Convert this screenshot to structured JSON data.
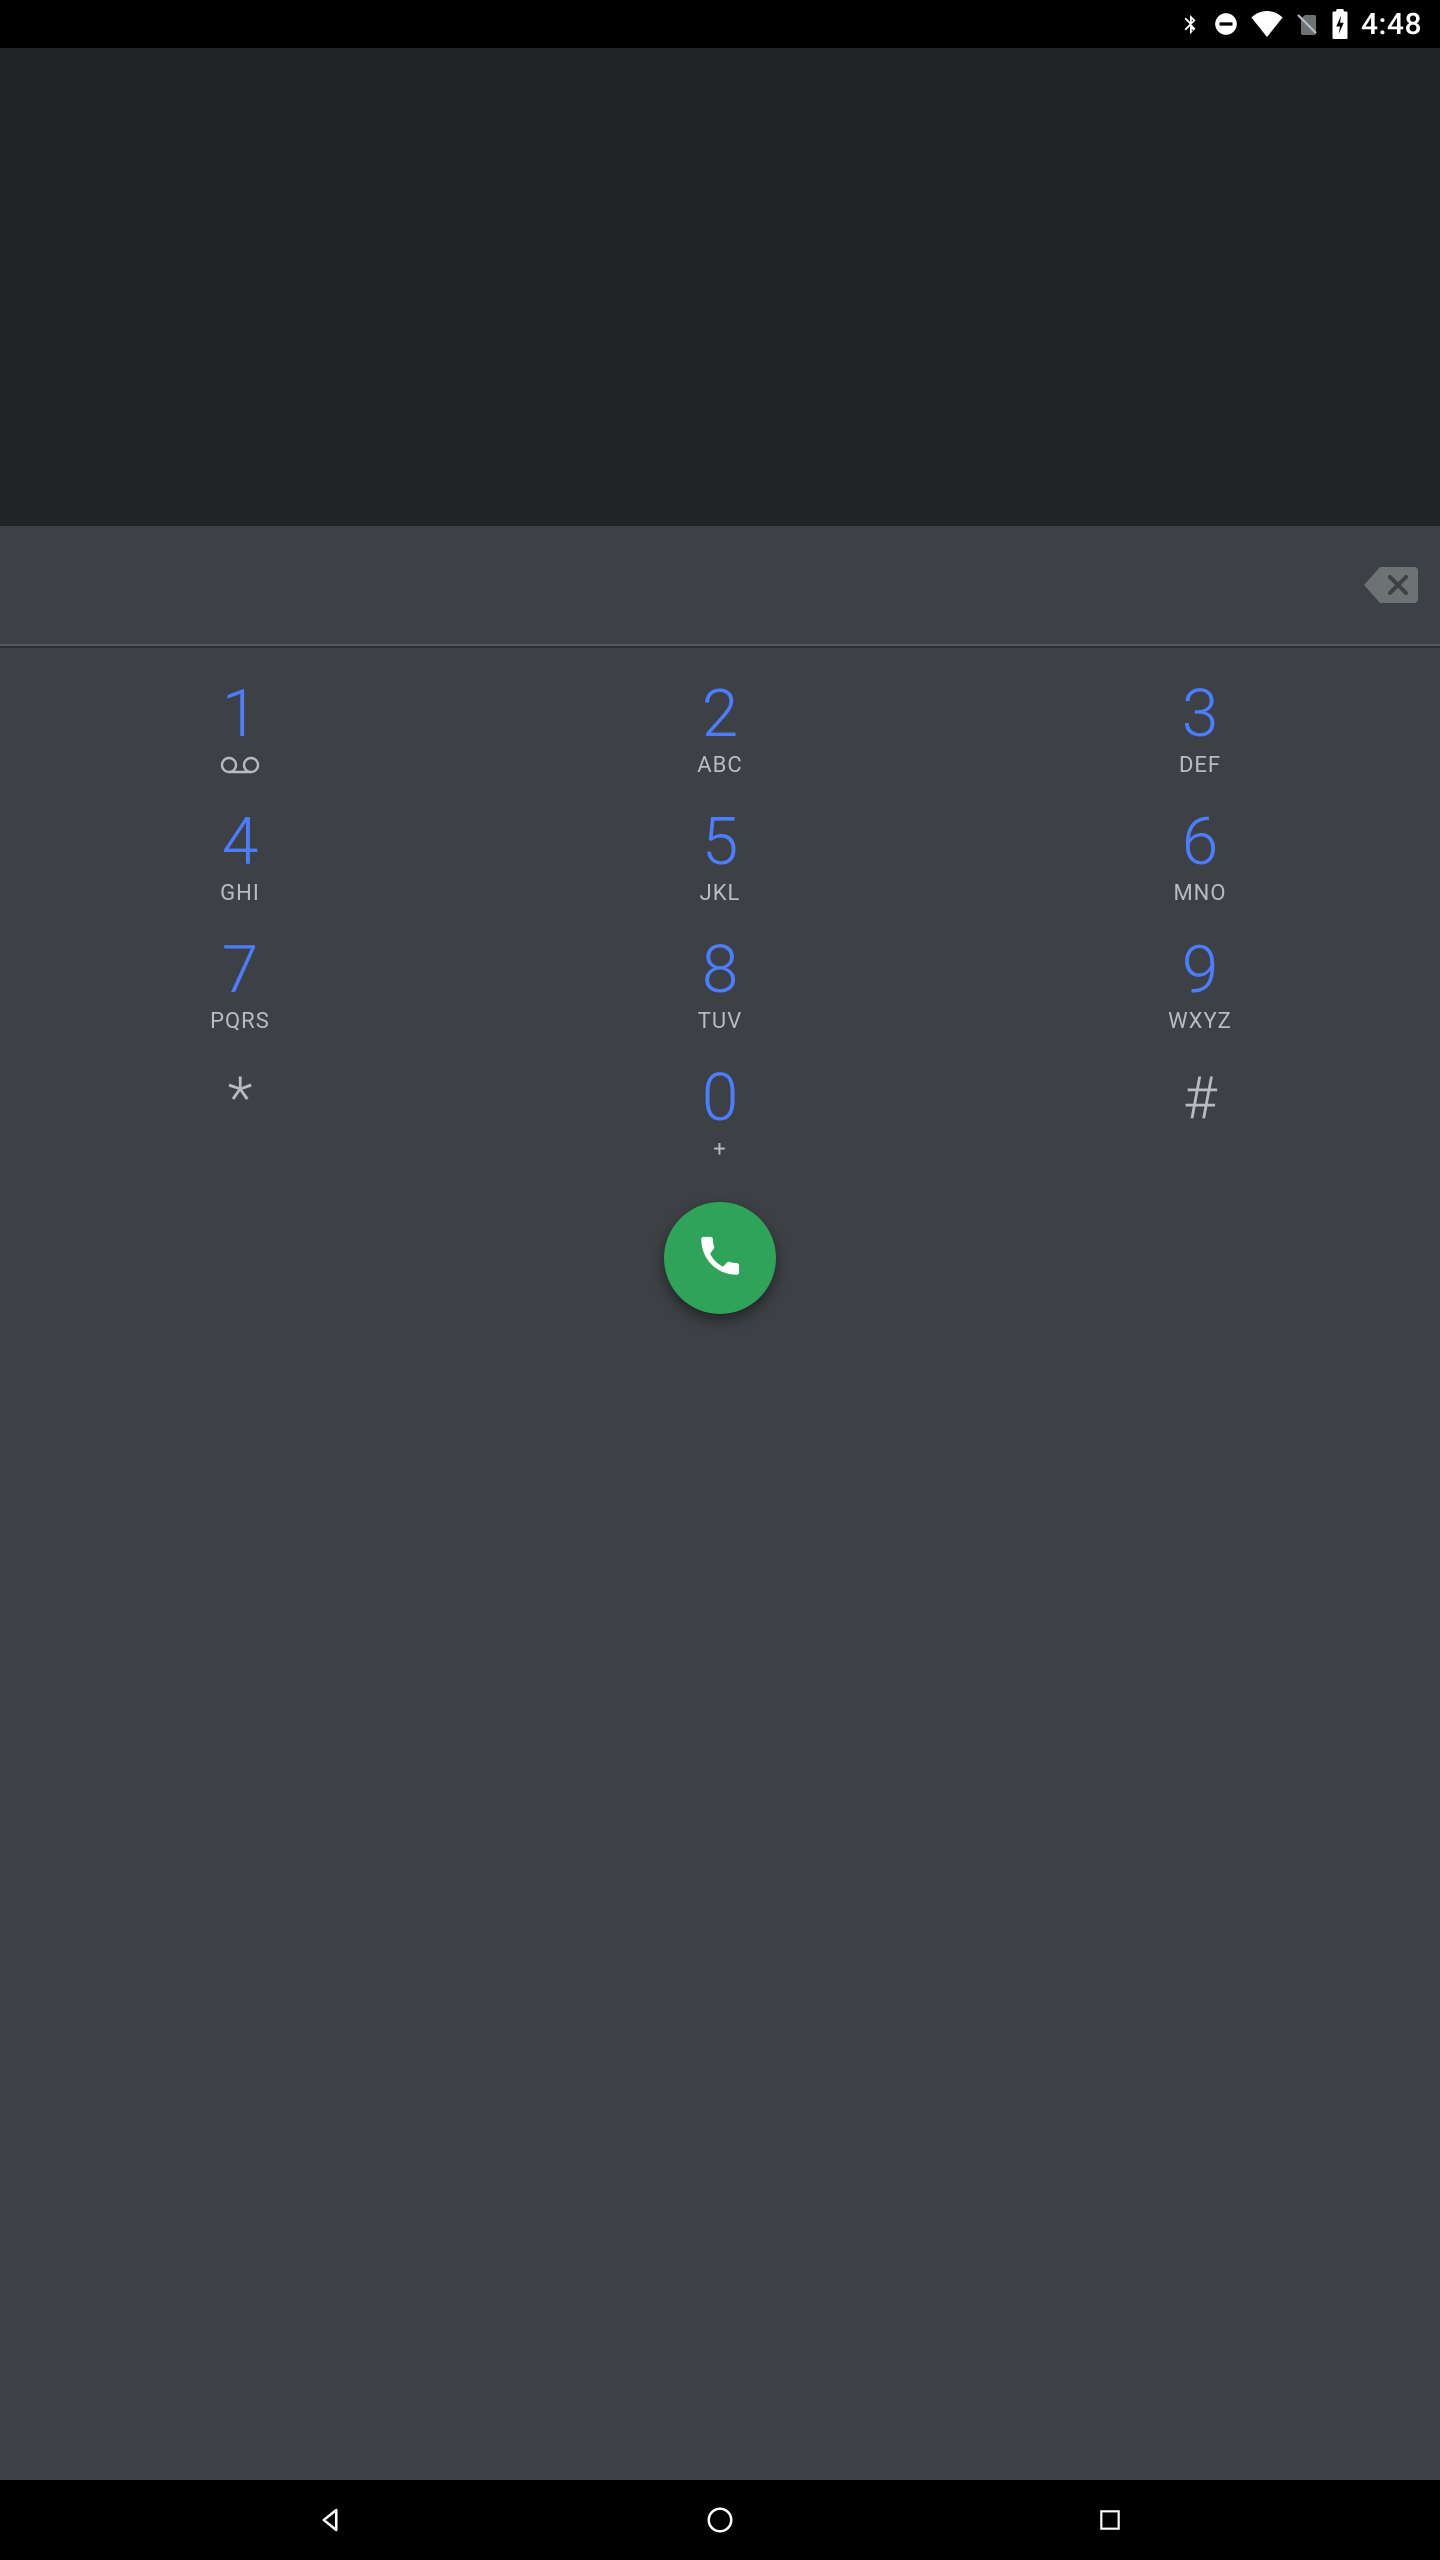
{
  "status_bar": {
    "time": "4:48"
  },
  "dialer": {
    "entered_number": "",
    "keys": [
      {
        "digit": "1",
        "letters": "",
        "voicemail": true
      },
      {
        "digit": "2",
        "letters": "ABC"
      },
      {
        "digit": "3",
        "letters": "DEF"
      },
      {
        "digit": "4",
        "letters": "GHI"
      },
      {
        "digit": "5",
        "letters": "JKL"
      },
      {
        "digit": "6",
        "letters": "MNO"
      },
      {
        "digit": "7",
        "letters": "PQRS"
      },
      {
        "digit": "8",
        "letters": "TUV"
      },
      {
        "digit": "9",
        "letters": "WXYZ"
      },
      {
        "digit": "*",
        "letters": "",
        "symbol_only": true
      },
      {
        "digit": "0",
        "letters": "+"
      },
      {
        "digit": "#",
        "letters": "",
        "symbol_only": true
      }
    ]
  },
  "colors": {
    "digit_blue": "#4d7dff",
    "call_green": "#2fa35a",
    "panel_dark": "#212327",
    "panel_mid": "#3d4145"
  }
}
